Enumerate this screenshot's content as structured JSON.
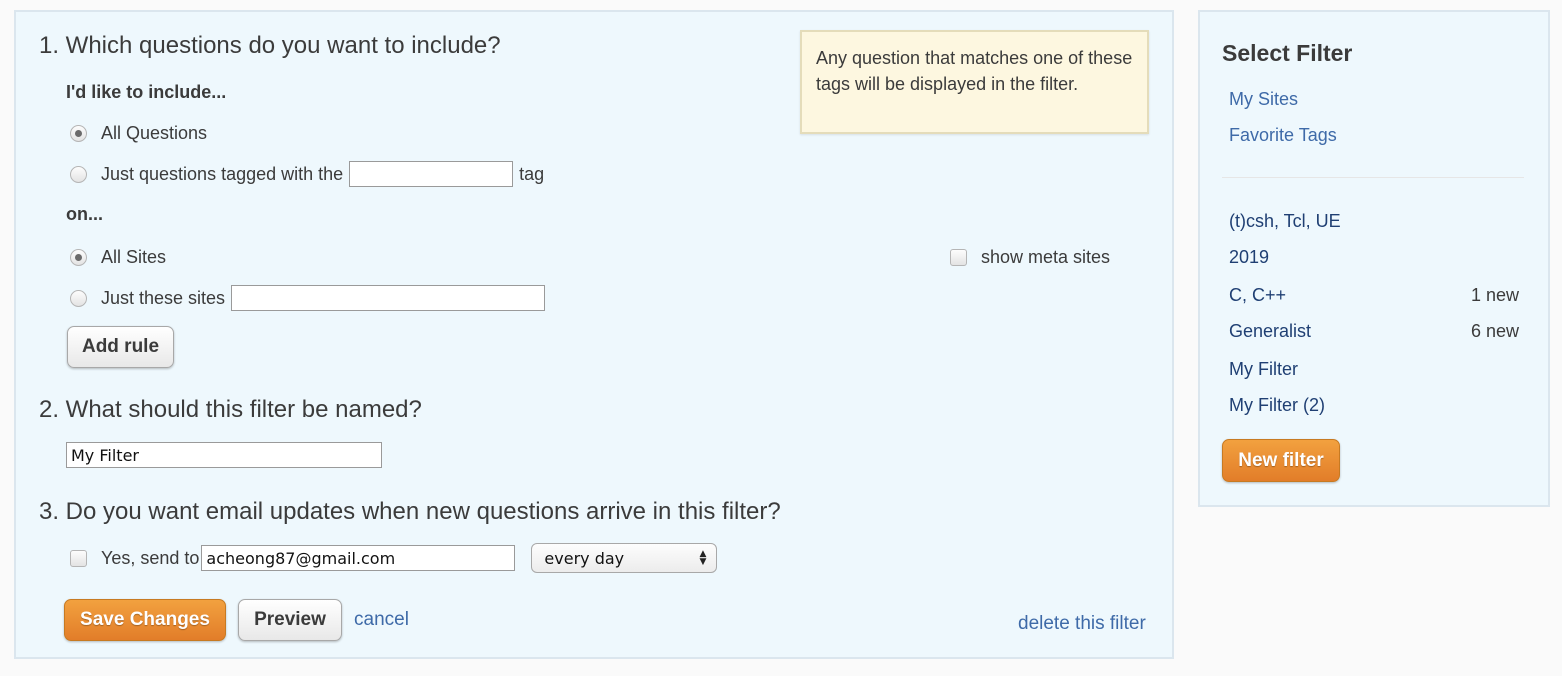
{
  "main": {
    "q1": {
      "title": "1. Which questions do you want to include?",
      "include_label": "I'd like to include...",
      "options": [
        {
          "label": "All Questions",
          "selected": true
        },
        {
          "label": "Just questions tagged with the",
          "suffix": "tag",
          "selected": false,
          "input_value": ""
        }
      ],
      "on_label": "on...",
      "site_options": [
        {
          "label": "All Sites",
          "selected": true
        },
        {
          "label": "Just these sites",
          "selected": false,
          "input_value": ""
        }
      ],
      "show_meta": {
        "label": "show meta sites",
        "checked": false
      },
      "add_rule_label": "Add rule",
      "note": "Any question that matches one of these tags will be displayed in the filter."
    },
    "q2": {
      "title": "2. What should this filter be named?",
      "name_value": "My Filter"
    },
    "q3": {
      "title": "3. Do you want email updates when new questions arrive in this filter?",
      "send_label": "Yes, send to",
      "send_checked": false,
      "email_value": "acheong87@gmail.com",
      "frequency": "every day"
    },
    "actions": {
      "save_label": "Save Changes",
      "preview_label": "Preview",
      "cancel_label": "cancel",
      "delete_label": "delete this filter"
    }
  },
  "sidebar": {
    "title": "Select Filter",
    "links": [
      "My Sites",
      "Favorite Tags"
    ],
    "filters": [
      {
        "name": "(t)csh, Tcl, UE",
        "count": ""
      },
      {
        "name": "2019",
        "count": ""
      },
      {
        "name": "C, C++",
        "count": "1 new"
      },
      {
        "name": "Generalist",
        "count": "6 new"
      },
      {
        "name": "My Filter",
        "count": ""
      },
      {
        "name": "My Filter (2)",
        "count": ""
      }
    ],
    "new_filter_label": "New filter"
  },
  "colors": {
    "panel_bg": "#eef8fd",
    "accent_orange": "#e8862f",
    "link_blue": "#3e6aa8",
    "note_bg": "#fdf7e0"
  }
}
